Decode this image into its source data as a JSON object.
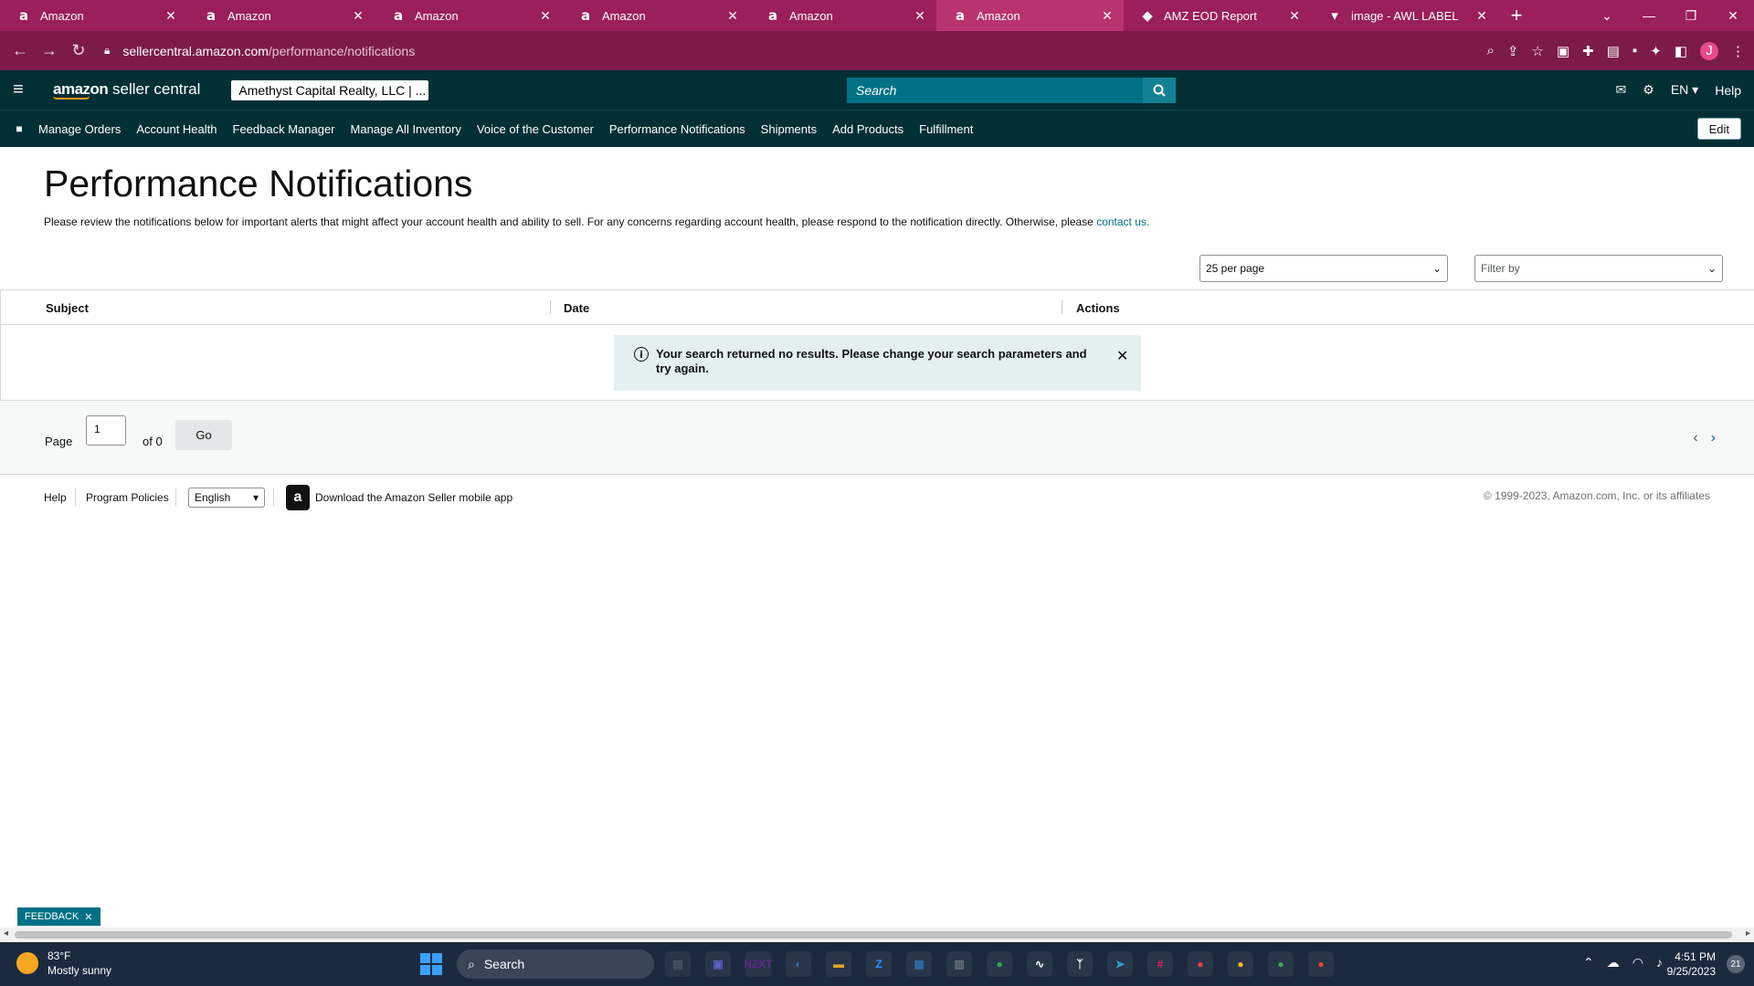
{
  "browser": {
    "tabs": [
      {
        "title": "Amazon",
        "favicon": "a"
      },
      {
        "title": "Amazon",
        "favicon": "a"
      },
      {
        "title": "Amazon",
        "favicon": "a"
      },
      {
        "title": "Amazon",
        "favicon": "a"
      },
      {
        "title": "Amazon",
        "favicon": "a"
      },
      {
        "title": "Amazon",
        "favicon": "a"
      },
      {
        "title": "AMZ EOD Report",
        "favicon": "◆"
      },
      {
        "title": "image - AWL LABEL",
        "favicon": "▾"
      }
    ],
    "active_tab_index": 5,
    "url_host": "sellercentral.amazon.com",
    "url_path": "/performance/notifications",
    "profile_initial": "J"
  },
  "header": {
    "logo_brand": "amazon",
    "logo_suffix": " seller central",
    "account": "Amethyst Capital Realty, LLC | ...",
    "search_placeholder": "Search",
    "language": "EN",
    "help": "Help"
  },
  "nav": {
    "items": [
      "Manage Orders",
      "Account Health",
      "Feedback Manager",
      "Manage All Inventory",
      "Voice of the Customer",
      "Performance Notifications",
      "Shipments",
      "Add Products",
      "Fulfillment"
    ],
    "edit": "Edit"
  },
  "main": {
    "title": "Performance Notifications",
    "intro_text": "Please review the notifications below for important alerts that might affect your account health and ability to sell. For any concerns regarding account health, please respond to the notification directly. Otherwise, please ",
    "intro_link": "contact us.",
    "per_page": "25 per page",
    "filter_placeholder": "Filter by",
    "columns": [
      "Subject",
      "Date",
      "Actions"
    ],
    "empty_message": "Your search returned no results. Please change your search parameters and try again."
  },
  "pager": {
    "page_label": "Page",
    "page_value": "1",
    "of_label": "of 0",
    "go": "Go"
  },
  "footer": {
    "help": "Help",
    "policies": "Program Policies",
    "language": "English",
    "app": "Download the Amazon Seller mobile app",
    "copyright": "© 1999-2023, Amazon.com, Inc. or its affiliates"
  },
  "feedback": "FEEDBACK",
  "taskbar": {
    "temp": "83°F",
    "weather": "Mostly sunny",
    "search": "Search",
    "time": "4:51 PM",
    "date": "9/25/2023",
    "notifications": "21",
    "apps": [
      {
        "name": "file-explorer",
        "label": "▤",
        "color": "#4a5568"
      },
      {
        "name": "teams",
        "label": "▣",
        "color": "#5b5fc7"
      },
      {
        "name": "nzxt",
        "label": "NZXT",
        "color": "#5b2a86"
      },
      {
        "name": "photos",
        "label": "◐",
        "color": "#2b6cb0"
      },
      {
        "name": "folder",
        "label": "▬",
        "color": "#e0a526"
      },
      {
        "name": "zoom",
        "label": "Z",
        "color": "#2d8cff"
      },
      {
        "name": "calendar",
        "label": "▦",
        "color": "#2b6cb0"
      },
      {
        "name": "calculator",
        "label": "▥",
        "color": "#6b7280"
      },
      {
        "name": "chrome",
        "label": "●",
        "color": "#34a853"
      },
      {
        "name": "app-chart",
        "label": "∿",
        "color": "#ffffff"
      },
      {
        "name": "app-red",
        "label": "ᛉ",
        "color": "#ffffff"
      },
      {
        "name": "telegram",
        "label": "➤",
        "color": "#2aa1da"
      },
      {
        "name": "slack",
        "label": "#",
        "color": "#e01e5a"
      },
      {
        "name": "chrome-2",
        "label": "●",
        "color": "#ea4335"
      },
      {
        "name": "chrome-3",
        "label": "●",
        "color": "#fbbc05"
      },
      {
        "name": "chrome-4",
        "label": "●",
        "color": "#34a853"
      },
      {
        "name": "chrome-5",
        "label": "●",
        "color": "#ea4335"
      }
    ]
  },
  "colors": {
    "browser_frame": "#9b1f5a",
    "header_bg": "#002f36",
    "link": "#007185"
  }
}
